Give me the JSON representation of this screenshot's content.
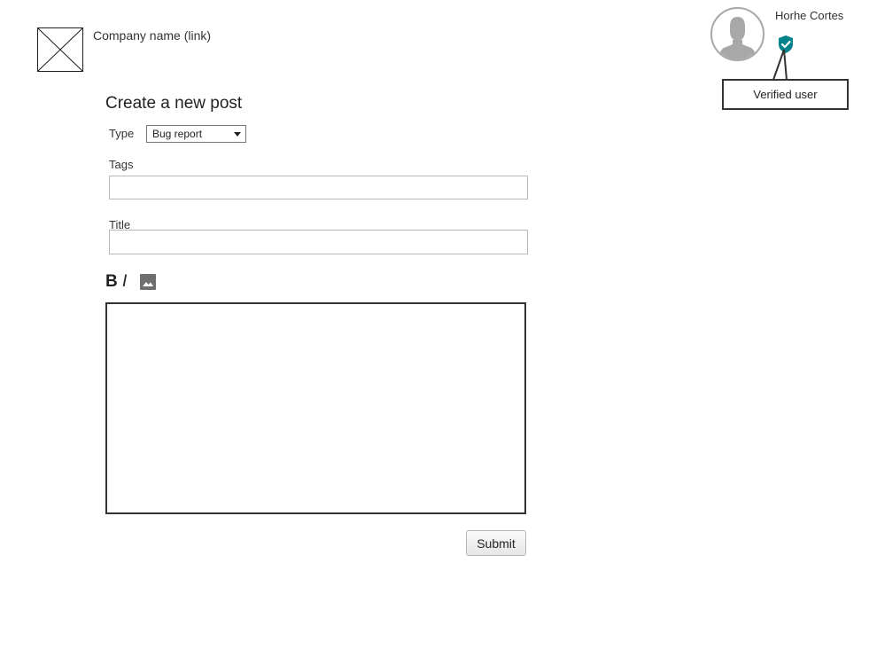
{
  "header": {
    "company_link": "Company name (link)",
    "logo_icon": "image-placeholder-icon"
  },
  "user": {
    "name": "Horhe Cortes",
    "avatar_icon": "user-avatar-icon",
    "badge_icon": "verified-shield-icon",
    "badge_color": "#00838a",
    "tooltip": "Verified user"
  },
  "form": {
    "title": "Create a new post",
    "type_label": "Type",
    "type_value": "Bug report",
    "tags_label": "Tags",
    "tags_value": "",
    "title_label": "Title",
    "title_value": "",
    "toolbar": {
      "bold_label": "B",
      "italic_label": "I",
      "image_icon": "image-icon"
    },
    "body_value": "",
    "submit_label": "Submit"
  }
}
